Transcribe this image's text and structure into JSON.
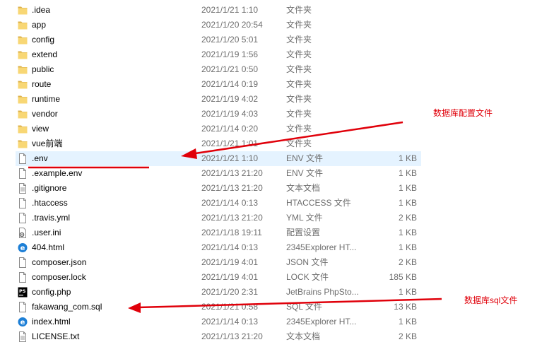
{
  "files": [
    {
      "name": ".idea",
      "date": "2021/1/21 1:10",
      "type": "文件夹",
      "size": "",
      "icon": "folder-icon"
    },
    {
      "name": "app",
      "date": "2021/1/20 20:54",
      "type": "文件夹",
      "size": "",
      "icon": "folder-icon"
    },
    {
      "name": "config",
      "date": "2021/1/20 5:01",
      "type": "文件夹",
      "size": "",
      "icon": "folder-icon"
    },
    {
      "name": "extend",
      "date": "2021/1/19 1:56",
      "type": "文件夹",
      "size": "",
      "icon": "folder-icon"
    },
    {
      "name": "public",
      "date": "2021/1/21 0:50",
      "type": "文件夹",
      "size": "",
      "icon": "folder-icon"
    },
    {
      "name": "route",
      "date": "2021/1/14 0:19",
      "type": "文件夹",
      "size": "",
      "icon": "folder-icon"
    },
    {
      "name": "runtime",
      "date": "2021/1/19 4:02",
      "type": "文件夹",
      "size": "",
      "icon": "folder-icon"
    },
    {
      "name": "vendor",
      "date": "2021/1/19 4:03",
      "type": "文件夹",
      "size": "",
      "icon": "folder-icon"
    },
    {
      "name": "view",
      "date": "2021/1/14 0:20",
      "type": "文件夹",
      "size": "",
      "icon": "folder-icon"
    },
    {
      "name": "vue前端",
      "date": "2021/1/21 1:01",
      "type": "文件夹",
      "size": "",
      "icon": "folder-icon"
    },
    {
      "name": ".env",
      "date": "2021/1/21 1:10",
      "type": "ENV 文件",
      "size": "1 KB",
      "icon": "document-icon",
      "selected": true
    },
    {
      "name": ".example.env",
      "date": "2021/1/13 21:20",
      "type": "ENV 文件",
      "size": "1 KB",
      "icon": "document-icon"
    },
    {
      "name": ".gitignore",
      "date": "2021/1/13 21:20",
      "type": "文本文档",
      "size": "1 KB",
      "icon": "text-document-icon"
    },
    {
      "name": ".htaccess",
      "date": "2021/1/14 0:13",
      "type": "HTACCESS 文件",
      "size": "1 KB",
      "icon": "document-icon"
    },
    {
      "name": ".travis.yml",
      "date": "2021/1/13 21:20",
      "type": "YML 文件",
      "size": "2 KB",
      "icon": "document-icon"
    },
    {
      "name": ".user.ini",
      "date": "2021/1/18 19:11",
      "type": "配置设置",
      "size": "1 KB",
      "icon": "config-settings-icon"
    },
    {
      "name": "404.html",
      "date": "2021/1/14 0:13",
      "type": "2345Explorer HT...",
      "size": "1 KB",
      "icon": "browser-e-icon"
    },
    {
      "name": "composer.json",
      "date": "2021/1/19 4:01",
      "type": "JSON 文件",
      "size": "2 KB",
      "icon": "document-icon"
    },
    {
      "name": "composer.lock",
      "date": "2021/1/19 4:01",
      "type": "LOCK 文件",
      "size": "185 KB",
      "icon": "document-icon"
    },
    {
      "name": "config.php",
      "date": "2021/1/20 2:31",
      "type": "JetBrains PhpSto...",
      "size": "1 KB",
      "icon": "phpstorm-icon"
    },
    {
      "name": "fakawang_com.sql",
      "date": "2021/1/21 0:58",
      "type": "SQL 文件",
      "size": "13 KB",
      "icon": "document-icon"
    },
    {
      "name": "index.html",
      "date": "2021/1/14 0:13",
      "type": "2345Explorer HT...",
      "size": "1 KB",
      "icon": "browser-e-icon"
    },
    {
      "name": "LICENSE.txt",
      "date": "2021/1/13 21:20",
      "type": "文本文档",
      "size": "2 KB",
      "icon": "text-document-icon"
    }
  ],
  "annotations": {
    "db_config": "数据库配置文件",
    "db_sql": "数据库sql文件"
  },
  "colors": {
    "annotation_red": "#e0000a",
    "selection": "#e5f3ff",
    "folder": "#f8d775",
    "folder_dark": "#dcb049",
    "muted_text": "#6d6d6d"
  }
}
